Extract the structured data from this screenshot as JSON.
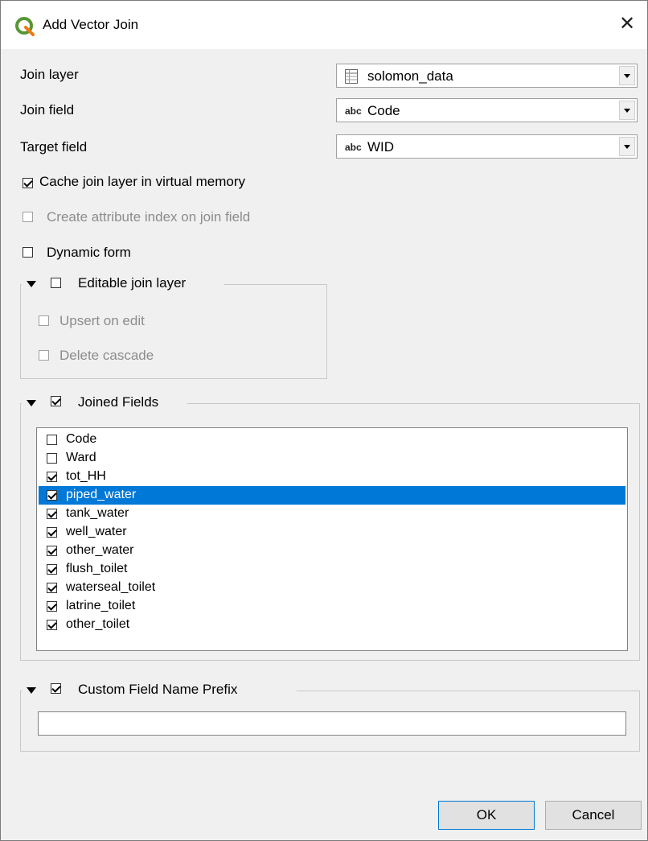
{
  "window": {
    "title": "Add Vector Join",
    "close_glyph": "✕"
  },
  "form": {
    "join_layer": {
      "label": "Join layer",
      "value": "solomon_data",
      "icon": "table-icon"
    },
    "join_field": {
      "label": "Join field",
      "value": "Code",
      "type_tag": "abc"
    },
    "target_field": {
      "label": "Target field",
      "value": "WID",
      "type_tag": "abc"
    }
  },
  "options": {
    "cache": {
      "label": "Cache join layer in virtual memory",
      "checked": true,
      "enabled": true
    },
    "index": {
      "label": "Create attribute index on join field",
      "checked": false,
      "enabled": false
    },
    "dynamic_form": {
      "label": "Dynamic form",
      "checked": false,
      "enabled": true
    }
  },
  "editable_group": {
    "title": "Editable join layer",
    "checked": false,
    "upsert": {
      "label": "Upsert on edit"
    },
    "delete_cascade": {
      "label": "Delete cascade"
    }
  },
  "joined_fields": {
    "title": "Joined Fields",
    "checked": true,
    "fields": [
      {
        "name": "Code",
        "checked": false,
        "selected": false
      },
      {
        "name": "Ward",
        "checked": false,
        "selected": false
      },
      {
        "name": "tot_HH",
        "checked": true,
        "selected": false
      },
      {
        "name": "piped_water",
        "checked": true,
        "selected": true
      },
      {
        "name": "tank_water",
        "checked": true,
        "selected": false
      },
      {
        "name": "well_water",
        "checked": true,
        "selected": false
      },
      {
        "name": "other_water",
        "checked": true,
        "selected": false
      },
      {
        "name": "flush_toilet",
        "checked": true,
        "selected": false
      },
      {
        "name": "waterseal_toilet",
        "checked": true,
        "selected": false
      },
      {
        "name": "latrine_toilet",
        "checked": true,
        "selected": false
      },
      {
        "name": "other_toilet",
        "checked": true,
        "selected": false
      }
    ]
  },
  "prefix_group": {
    "title": "Custom Field Name Prefix",
    "checked": true,
    "value": ""
  },
  "buttons": {
    "ok": "OK",
    "cancel": "Cancel"
  },
  "colors": {
    "selection": "#0078d7",
    "qgis_green": "#589632",
    "qgis_yellow": "#ee7913"
  }
}
